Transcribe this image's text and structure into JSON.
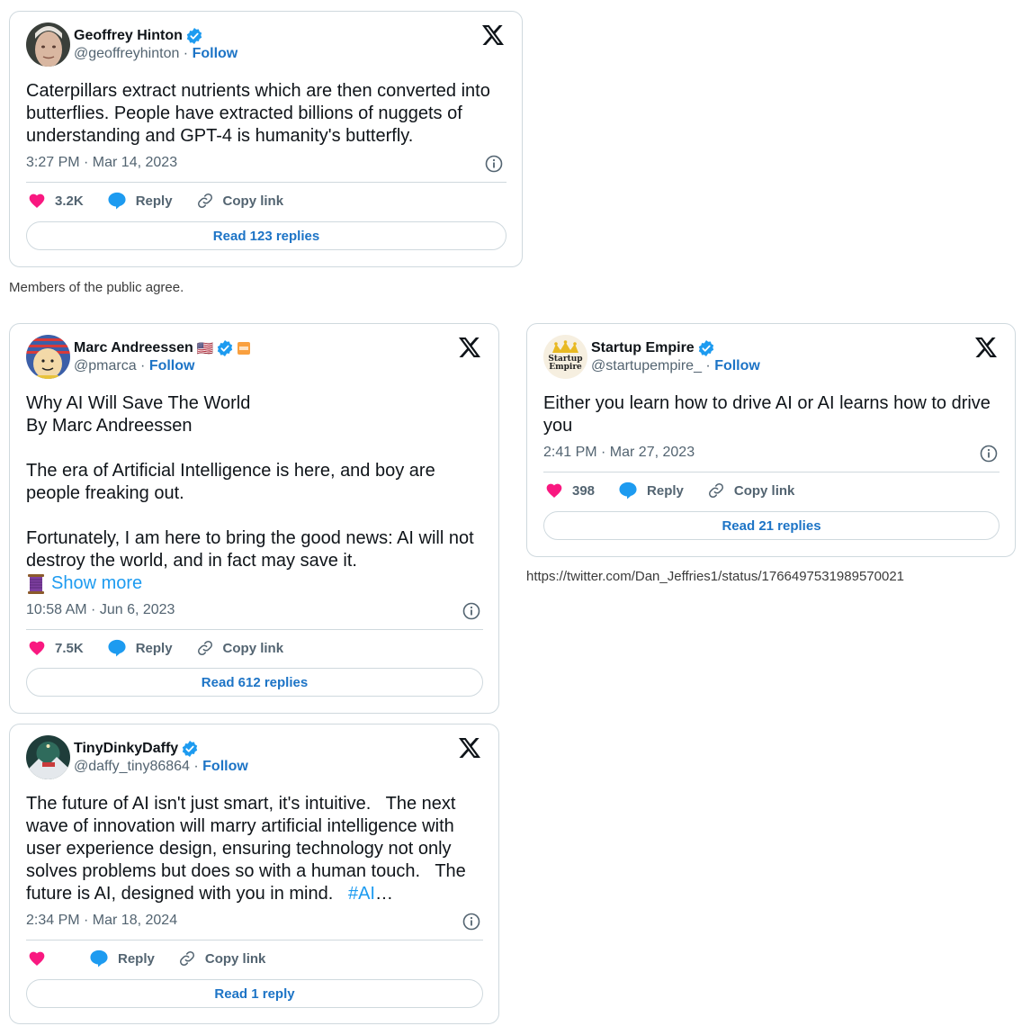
{
  "tweets": [
    {
      "name": "Geoffrey Hinton",
      "handle": "@geoffreyhinton",
      "follow": "Follow",
      "text": "Caterpillars extract nutrients which are then converted into butterflies. People have extracted billions of nuggets of understanding and GPT-4 is humanity's butterfly.",
      "time": "3:27 PM · Mar 14, 2023",
      "likes": "3.2K",
      "reply": "Reply",
      "copy": "Copy link",
      "read": "Read 123 replies"
    },
    {
      "name": "Marc Andreessen",
      "flag": "🇺🇸",
      "handle": "@pmarca",
      "follow": "Follow",
      "text": "Why AI Will Save The World\nBy Marc Andreessen\n\nThe era of Artificial Intelligence is here, and boy are people freaking out.\n\nFortunately, I am here to bring the good news: AI will not destroy the world, and in fact may save it.",
      "thread_icon": "thread-spool-icon",
      "show_more": "Show more",
      "time": "10:58 AM · Jun 6, 2023",
      "likes": "7.5K",
      "reply": "Reply",
      "copy": "Copy link",
      "read": "Read 612 replies"
    },
    {
      "name": "Startup Empire",
      "handle": "@startupempire_",
      "follow": "Follow",
      "avatar_text": "Startup Empire",
      "text": "Either you learn how to drive AI or AI learns how to drive you",
      "time": "2:41 PM · Mar 27, 2023",
      "likes": "398",
      "reply": "Reply",
      "copy": "Copy link",
      "read": "Read 21 replies"
    },
    {
      "name": "TinyDinkyDaffy",
      "handle": "@daffy_tiny86864",
      "follow": "Follow",
      "text": "The future of AI isn't just smart, it's intuitive.   The next wave of innovation will marry artificial intelligence with user experience design, ensuring technology not only solves problems but does so with a human touch.   The future is AI, designed with you in mind.   ",
      "hashtag": "#AI",
      "ellipsis": "…",
      "time": "2:34 PM · Mar 18, 2024",
      "likes": "",
      "reply": "Reply",
      "copy": "Copy link",
      "read": "Read 1 reply"
    }
  ],
  "captions": {
    "members": "Members of the public agree.",
    "url": "https://twitter.com/Dan_Jeffries1/status/1766497531989570021"
  },
  "colors": {
    "border": "#cfd9de",
    "link_blue": "#1d74c6",
    "hashtag_blue": "#1d9bf0",
    "heart": "#f91880",
    "muted": "#536471"
  }
}
